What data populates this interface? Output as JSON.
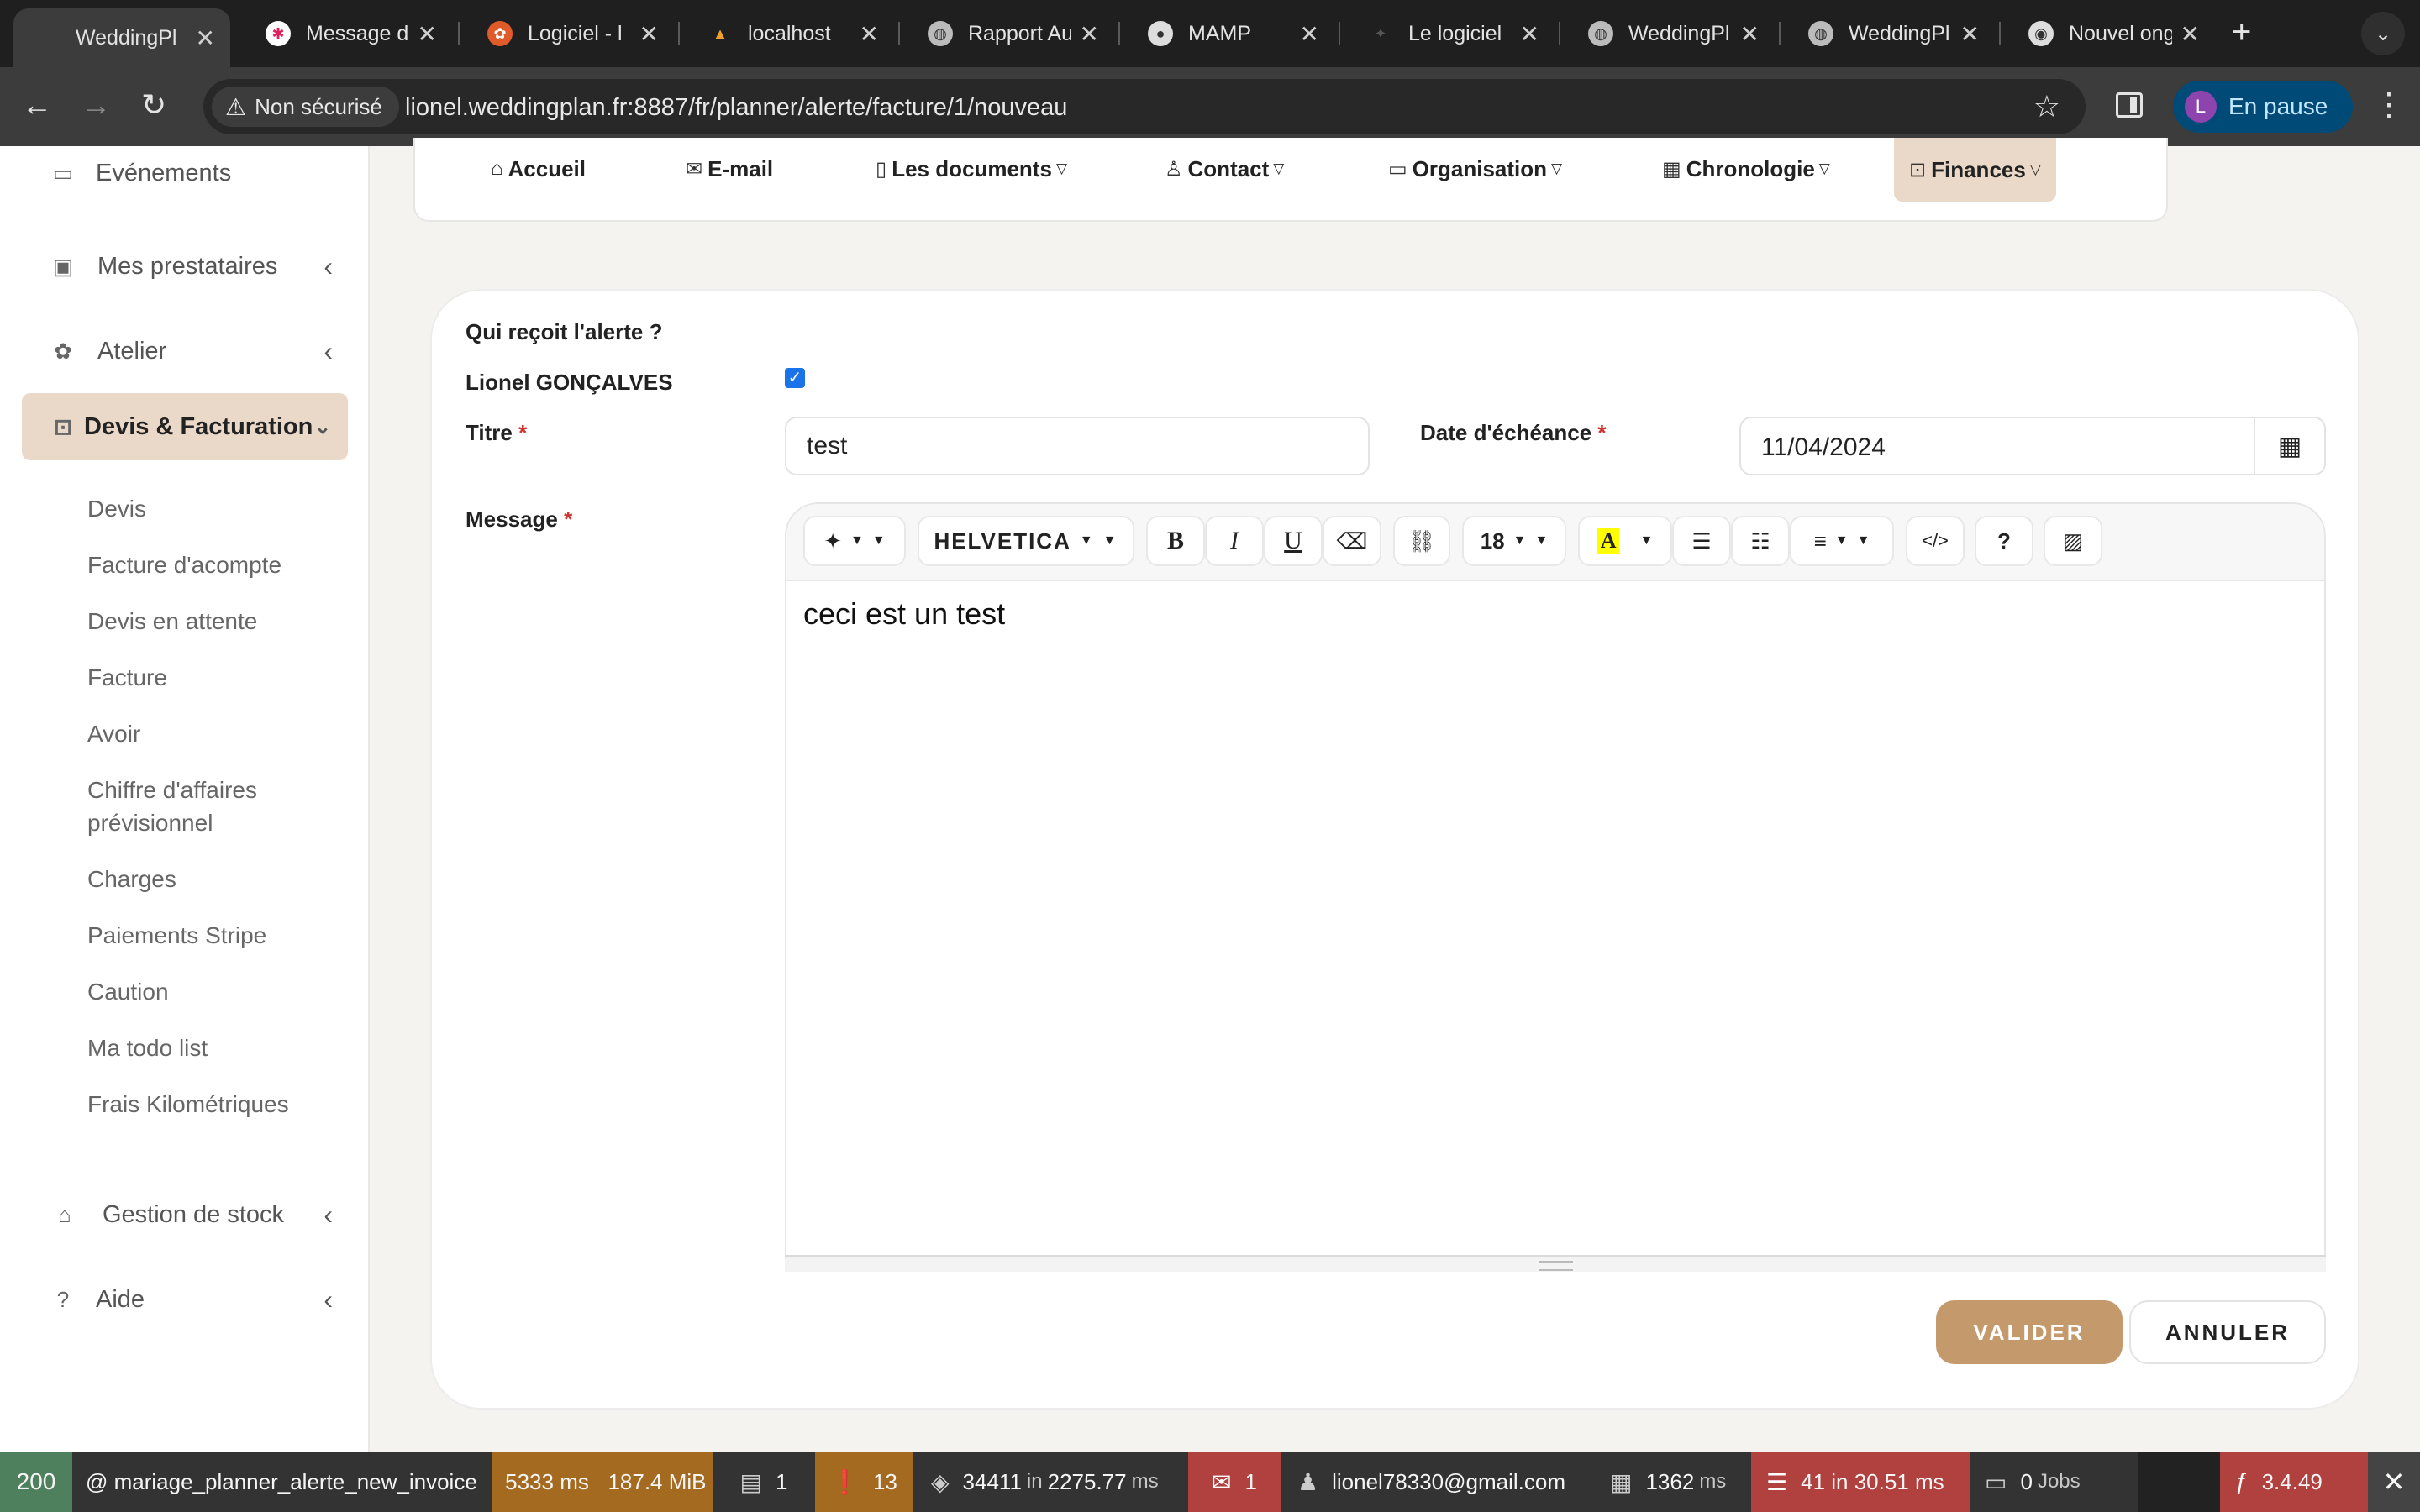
{
  "browser": {
    "tabs": [
      {
        "title": "WeddingPl",
        "active": true,
        "favicon": "wedding-dot"
      },
      {
        "title": "Message d",
        "favicon": "slack-icon"
      },
      {
        "title": "Logiciel - l",
        "favicon": "logo-icon"
      },
      {
        "title": "localhost",
        "favicon": "localhost-icon"
      },
      {
        "title": "Rapport Au",
        "favicon": "globe-icon"
      },
      {
        "title": "MAMP",
        "favicon": "mamp-icon"
      },
      {
        "title": "Le logiciel",
        "favicon": "logo-icon"
      },
      {
        "title": "WeddingPl",
        "favicon": "globe-icon"
      },
      {
        "title": "WeddingPl",
        "favicon": "globe-icon"
      },
      {
        "title": "Nouvel ong",
        "favicon": "chrome-icon"
      }
    ],
    "security_label": "Non sécurisé",
    "url": "lionel.weddingplan.fr:8887/fr/planner/alerte/facture/1/nouveau",
    "profile_initial": "L",
    "profile_label": "En pause"
  },
  "sidebar": {
    "items": [
      {
        "label": "Evénements",
        "icon": "calendar-icon"
      },
      {
        "label": "Mes prestataires",
        "icon": "contacts-icon"
      },
      {
        "label": "Atelier",
        "icon": "flower-icon"
      },
      {
        "label": "Devis & Facturation",
        "icon": "money-icon",
        "active": true
      },
      {
        "label": "Gestion de stock",
        "icon": "store-icon"
      },
      {
        "label": "Aide",
        "icon": "help-icon"
      }
    ],
    "subitems": [
      "Devis",
      "Facture d'acompte",
      "Devis en attente",
      "Facture",
      "Avoir",
      "Chiffre d'affaires prévisionnel",
      "Charges",
      "Paiements Stripe",
      "Caution",
      "Ma todo list",
      "Frais Kilométriques"
    ]
  },
  "topnav": [
    {
      "label": "Accueil",
      "icon": "home-icon"
    },
    {
      "label": "E-mail",
      "icon": "mail-icon"
    },
    {
      "label": "Les documents",
      "icon": "document-icon"
    },
    {
      "label": "Contact",
      "icon": "user-icon"
    },
    {
      "label": "Organisation",
      "icon": "organisation-icon"
    },
    {
      "label": "Chronologie",
      "icon": "calendar-icon"
    },
    {
      "label": "Finances",
      "icon": "money-icon",
      "active": true
    }
  ],
  "form": {
    "recipients_label": "Qui reçoit l'alerte ?",
    "recipient_name": "Lionel GONÇALVES",
    "recipient_checked": true,
    "title_label": "Titre",
    "title_value": "test",
    "due_date_label": "Date d'échéance",
    "due_date_value": "11/04/2024",
    "message_label": "Message",
    "required_mark": "*",
    "editor": {
      "font_name": "HELVETICA",
      "font_size": "18",
      "content": "ceci est un test"
    },
    "submit_label": "VALIDER",
    "cancel_label": "ANNULER"
  },
  "debug_toolbar": {
    "status_code": "200",
    "route": "@ mariage_planner_alerte_new_invoice",
    "time": "5333 ms",
    "memory": "187.4 MiB",
    "forms": "1",
    "warnings": "13",
    "cache_count": "34411",
    "cache_in": "in",
    "cache_time": "2275.77",
    "cache_unit": "ms",
    "translations": "1",
    "user": "lionel78330@gmail.com",
    "twig_time": "1362",
    "twig_unit": "ms",
    "db_queries": "41 in 30.51 ms",
    "jobs": "0",
    "jobs_label": "Jobs",
    "symfony_version": "3.4.49"
  },
  "colors": {
    "accent": "#c49a6c",
    "accent_light": "#ead9c8",
    "required": "#d0342c"
  }
}
